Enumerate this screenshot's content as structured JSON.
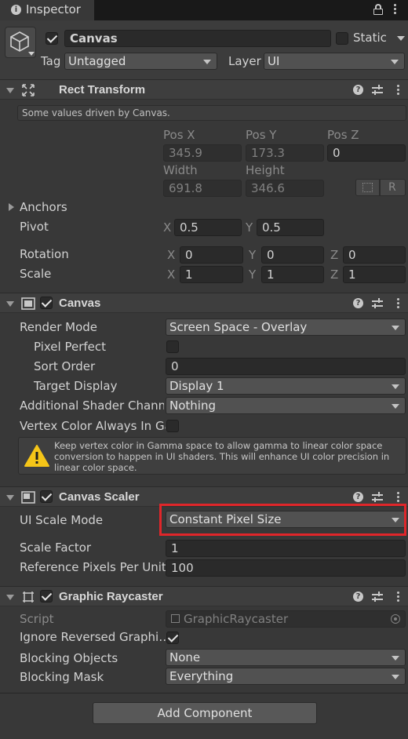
{
  "tab": {
    "title": "Inspector"
  },
  "gameobject": {
    "name": "Canvas",
    "static_label": "Static",
    "tag_label": "Tag",
    "tag_value": "Untagged",
    "layer_label": "Layer",
    "layer_value": "UI"
  },
  "rect_transform": {
    "title": "Rect Transform",
    "note": "Some values driven by Canvas.",
    "pos_x_label": "Pos X",
    "pos_y_label": "Pos Y",
    "pos_z_label": "Pos Z",
    "pos_x": "345.9",
    "pos_y": "173.3",
    "pos_z": "0",
    "width_label": "Width",
    "height_label": "Height",
    "width": "691.8",
    "height": "346.6",
    "r_button": "R",
    "anchors_label": "Anchors",
    "pivot_label": "Pivot",
    "pivot_x": "0.5",
    "pivot_y": "0.5",
    "rotation_label": "Rotation",
    "rotation": {
      "x": "0",
      "y": "0",
      "z": "0"
    },
    "scale_label": "Scale",
    "scale": {
      "x": "1",
      "y": "1",
      "z": "1"
    },
    "axis_x": "X",
    "axis_y": "Y",
    "axis_z": "Z"
  },
  "canvas": {
    "title": "Canvas",
    "render_mode_label": "Render Mode",
    "render_mode": "Screen Space - Overlay",
    "pixel_perfect_label": "Pixel Perfect",
    "sort_order_label": "Sort Order",
    "sort_order": "0",
    "target_display_label": "Target Display",
    "target_display": "Display 1",
    "shader_channels_label": "Additional Shader Channe",
    "shader_channels": "Nothing",
    "vertex_color_label": "Vertex Color Always In Ga",
    "warning_text": "Keep vertex color in Gamma space to allow gamma to linear color space conversion to happen in UI shaders. This will enhance UI color precision in linear color space."
  },
  "canvas_scaler": {
    "title": "Canvas Scaler",
    "ui_scale_mode_label": "UI Scale Mode",
    "ui_scale_mode": "Constant Pixel Size",
    "scale_factor_label": "Scale Factor",
    "scale_factor": "1",
    "ref_ppu_label": "Reference Pixels Per Unit",
    "ref_ppu": "100"
  },
  "graphic_raycaster": {
    "title": "Graphic Raycaster",
    "script_label": "Script",
    "script_value": "GraphicRaycaster",
    "ignore_reversed_label": "Ignore Reversed Graphi…",
    "blocking_objects_label": "Blocking Objects",
    "blocking_objects": "None",
    "blocking_mask_label": "Blocking Mask",
    "blocking_mask": "Everything"
  },
  "add_component_label": "Add Component",
  "colors": {
    "highlight": "#e0262a",
    "warning": "#f5c518",
    "panel": "#383838"
  }
}
